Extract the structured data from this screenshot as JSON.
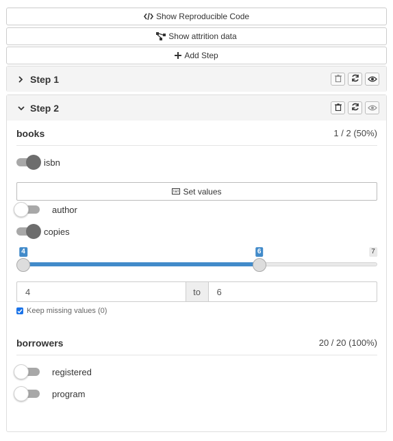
{
  "toolbar": {
    "show_code_label": "Show Reproducible Code",
    "show_attrition_label": "Show attrition data",
    "add_step_label": "Add Step"
  },
  "steps": [
    {
      "title": "Step 1"
    },
    {
      "title": "Step 2"
    }
  ],
  "books": {
    "name": "books",
    "count": "1 / 2 (50%)",
    "isbn_label": "isbn",
    "set_values_label": "Set values",
    "author_label": "author",
    "copies_label": "copies",
    "slider": {
      "min": 4,
      "max": 7,
      "from": 4,
      "to": 6,
      "from_tag": "4",
      "to_tag": "6",
      "max_tag": "7"
    },
    "range_from": "4",
    "range_to_label": "to",
    "range_to": "6",
    "keep_missing_label": "Keep missing values (0)"
  },
  "borrowers": {
    "name": "borrowers",
    "count": "20 / 20 (100%)",
    "registered_label": "registered",
    "program_label": "program"
  },
  "colors": {
    "accent": "#428bca",
    "checkbox": "#1a73e8"
  },
  "icons": {
    "code": "code-icon",
    "attrition": "sitemap-icon",
    "add": "plus-icon",
    "keyboard": "keyboard-icon",
    "trash": "trash-icon",
    "refresh": "refresh-icon",
    "eye": "eye-icon"
  }
}
